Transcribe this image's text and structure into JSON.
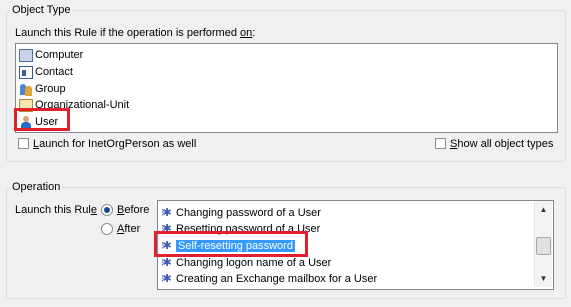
{
  "object_type": {
    "title": "Object Type",
    "prompt_pre": "Launch this Rule if the operation is performed ",
    "prompt_ul": "on",
    "prompt_post": ":",
    "items": [
      {
        "label": "Computer",
        "icon": "computer-icon"
      },
      {
        "label": "Contact",
        "icon": "contact-icon"
      },
      {
        "label": "Group",
        "icon": "group-icon"
      },
      {
        "label": "Organizational-Unit",
        "icon": "organizational-unit-icon"
      },
      {
        "label": "User",
        "icon": "user-icon"
      }
    ],
    "inetorg_ul": "L",
    "inetorg_rest": "aunch for InetOrgPerson as well",
    "show_all_ul": "S",
    "show_all_rest": "how all object types"
  },
  "operation": {
    "title": "Operation",
    "launch_pre": "Launch this Rul",
    "launch_ul": "e",
    "before_ul": "B",
    "before_rest": "efore",
    "before_checked": true,
    "after_ul": "A",
    "after_rest": "fter",
    "after_checked": false,
    "items": [
      {
        "label": "Changing password of a User",
        "selected": false
      },
      {
        "label": "Resetting password of a User",
        "selected": false
      },
      {
        "label": "Self-resetting password",
        "selected": true
      },
      {
        "label": "Changing logon name of a User",
        "selected": false
      },
      {
        "label": "Creating an Exchange mailbox for a User",
        "selected": false
      }
    ]
  },
  "icons": {
    "scroll_up": "▲",
    "scroll_down": "▼",
    "gear": "⁝✱"
  },
  "colors": {
    "highlight": "#e0202c",
    "selection": "#3399ff"
  }
}
